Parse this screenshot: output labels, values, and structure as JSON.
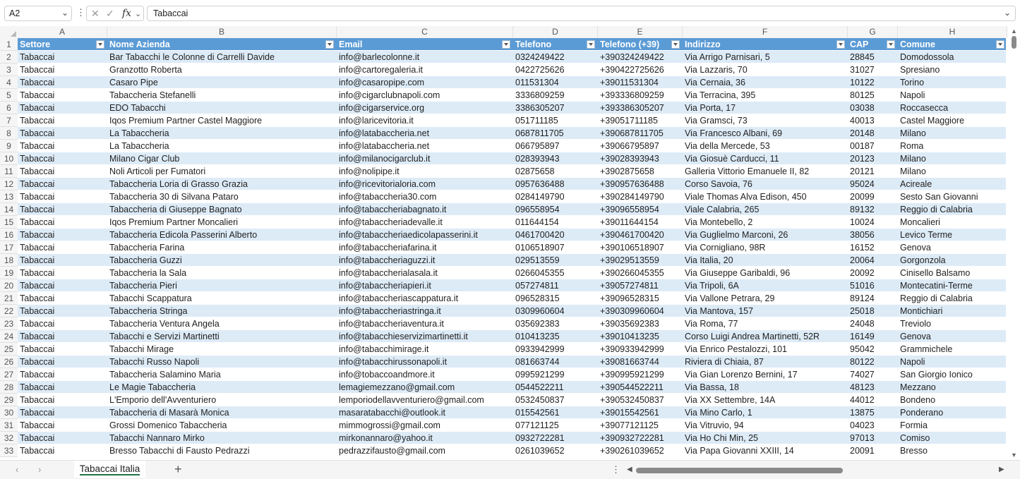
{
  "formula_bar": {
    "name_box": "A2",
    "formula": "Tabaccai"
  },
  "columns": [
    "A",
    "B",
    "C",
    "D",
    "E",
    "F",
    "G",
    "H"
  ],
  "header": [
    "Settore",
    "Nome Azienda",
    "Email",
    "Telefono",
    "Telefono (+39)",
    "Indirizzo",
    "CAP",
    "Comune"
  ],
  "rows": [
    [
      "Tabaccai",
      "Bar Tabacchi le Colonne di Carrelli Davide",
      "info@barlecolonne.it",
      "0324249422",
      "+390324249422",
      "Via Arrigo Parnisari, 5",
      "28845",
      "Domodossola"
    ],
    [
      "Tabaccai",
      "Granzotto Roberta",
      "info@cartoregaleria.it",
      "0422725626",
      "+390422725626",
      "Via Lazzaris, 70",
      "31027",
      "Spresiano"
    ],
    [
      "Tabaccai",
      "Casaro Pipe",
      "info@casaropipe.com",
      "011531304",
      "+39011531304",
      "Via Cernaia, 36",
      "10122",
      "Torino"
    ],
    [
      "Tabaccai",
      "Tabaccheria Stefanelli",
      "info@cigarclubnapoli.com",
      "3336809259",
      "+393336809259",
      "Via Terracina, 395",
      "80125",
      "Napoli"
    ],
    [
      "Tabaccai",
      "EDO Tabacchi",
      "info@cigarservice.org",
      "3386305207",
      "+393386305207",
      "Via Porta, 17",
      "03038",
      "Roccasecca"
    ],
    [
      "Tabaccai",
      "Iqos Premium Partner Castel Maggiore",
      "info@laricevitoria.it",
      "051711185",
      "+39051711185",
      "Via Gramsci, 73",
      "40013",
      "Castel Maggiore"
    ],
    [
      "Tabaccai",
      "La Tabaccheria",
      "info@latabaccheria.net",
      "0687811705",
      "+390687811705",
      "Via Francesco Albani, 69",
      "20148",
      "Milano"
    ],
    [
      "Tabaccai",
      "La Tabaccheria",
      "info@latabaccheria.net",
      "066795897",
      "+39066795897",
      "Via della Mercede, 53",
      "00187",
      "Roma"
    ],
    [
      "Tabaccai",
      "Milano Cigar Club",
      "info@milanocigarclub.it",
      "028393943",
      "+39028393943",
      "Via Giosuè Carducci, 11",
      "20123",
      "Milano"
    ],
    [
      "Tabaccai",
      "Noli Articoli per Fumatori",
      "info@nolipipe.it",
      "02875658",
      "+3902875658",
      "Galleria Vittorio Emanuele II, 82",
      "20121",
      "Milano"
    ],
    [
      "Tabaccai",
      "Tabaccheria Loria di Grasso Grazia",
      "info@ricevitorialoria.com",
      "0957636488",
      "+390957636488",
      "Corso Savoia, 76",
      "95024",
      "Acireale"
    ],
    [
      "Tabaccai",
      "Tabaccheria 30 di Silvana Pataro",
      "info@tabaccheria30.com",
      "0284149790",
      "+390284149790",
      "Viale Thomas Alva Edison, 450",
      "20099",
      "Sesto San Giovanni"
    ],
    [
      "Tabaccai",
      "Tabaccheria di Giuseppe Bagnato",
      "info@tabaccheriabagnato.it",
      "096558954",
      "+39096558954",
      "Viale Calabria, 265",
      "89132",
      "Reggio di Calabria"
    ],
    [
      "Tabaccai",
      "Iqos Premium Partner Moncalieri",
      "info@tabaccheriadevalle.it",
      "011644154",
      "+39011644154",
      "Via Montebello, 2",
      "10024",
      "Moncalieri"
    ],
    [
      "Tabaccai",
      "Tabaccheria Edicola Passerini Alberto",
      "info@tabaccheriaedicolapasserini.it",
      "0461700420",
      "+390461700420",
      "Via Guglielmo Marconi, 26",
      "38056",
      "Levico Terme"
    ],
    [
      "Tabaccai",
      "Tabaccheria Farina",
      "info@tabaccheriafarina.it",
      "0106518907",
      "+390106518907",
      "Via Cornigliano, 98R",
      "16152",
      "Genova"
    ],
    [
      "Tabaccai",
      "Tabaccheria Guzzi",
      "info@tabaccheriaguzzi.it",
      "029513559",
      "+39029513559",
      "Via Italia, 20",
      "20064",
      "Gorgonzola"
    ],
    [
      "Tabaccai",
      "Tabaccheria la Sala",
      "info@tabaccherialasala.it",
      "0266045355",
      "+390266045355",
      "Via Giuseppe Garibaldi, 96",
      "20092",
      "Cinisello Balsamo"
    ],
    [
      "Tabaccai",
      "Tabaccheria Pieri",
      "info@tabaccheriapieri.it",
      "057274811",
      "+39057274811",
      "Via Tripoli, 6A",
      "51016",
      "Montecatini-Terme"
    ],
    [
      "Tabaccai",
      "Tabacchi Scappatura",
      "info@tabaccheriascappatura.it",
      "096528315",
      "+39096528315",
      "Via Vallone Petrara, 29",
      "89124",
      "Reggio di Calabria"
    ],
    [
      "Tabaccai",
      "Tabaccheria Stringa",
      "info@tabaccheriastringa.it",
      "0309960604",
      "+390309960604",
      "Via Mantova, 157",
      "25018",
      "Montichiari"
    ],
    [
      "Tabaccai",
      "Tabaccheria Ventura Angela",
      "info@tabaccheriaventura.it",
      "035692383",
      "+39035692383",
      "Via Roma, 77",
      "24048",
      "Treviolo"
    ],
    [
      "Tabaccai",
      "Tabacchi e Servizi Martinetti",
      "info@tabacchieservizimartinetti.it",
      "010413235",
      "+39010413235",
      "Corso Luigi Andrea Martinetti, 52R",
      "16149",
      "Genova"
    ],
    [
      "Tabaccai",
      "Tabacchi Mirage",
      "info@tabacchimirage.it",
      "0933942999",
      "+390933942999",
      "Via Enrico Pestalozzi, 101",
      "95042",
      "Grammichele"
    ],
    [
      "Tabaccai",
      "Tabacchi Russo Napoli",
      "info@tabacchirussonapoli.it",
      "081663744",
      "+39081663744",
      "Riviera di Chiaia, 87",
      "80122",
      "Napoli"
    ],
    [
      "Tabaccai",
      "Tabaccheria Salamino Maria",
      "info@tobaccoandmore.it",
      "0995921299",
      "+390995921299",
      "Via Gian Lorenzo Bernini, 17",
      "74027",
      "San Giorgio Ionico"
    ],
    [
      "Tabaccai",
      "Le Magie Tabaccheria",
      "lemagiemezzano@gmail.com",
      "0544522211",
      "+390544522211",
      "Via Bassa, 18",
      "48123",
      "Mezzano"
    ],
    [
      "Tabaccai",
      "L'Emporio dell'Avventuriero",
      "lemporiodellavventuriero@gmail.com",
      "0532450837",
      "+390532450837",
      "Via XX Settembre, 14A",
      "44012",
      "Bondeno"
    ],
    [
      "Tabaccai",
      "Tabaccheria di Masarà Monica",
      "masaratabacchi@outlook.it",
      "015542561",
      "+39015542561",
      "Via Mino Carlo, 1",
      "13875",
      "Ponderano"
    ],
    [
      "Tabaccai",
      "Grossi Domenico Tabaccheria",
      "mimmogrossi@gmail.com",
      "077121125",
      "+39077121125",
      "Via Vitruvio, 94",
      "04023",
      "Formia"
    ],
    [
      "Tabaccai",
      "Tabacchi Nannaro Mirko",
      "mirkonannaro@yahoo.it",
      "0932722281",
      "+390932722281",
      "Via Ho Chi Min, 25",
      "97013",
      "Comiso"
    ],
    [
      "Tabaccai",
      "Bresso Tabacchi di Fausto Pedrazzi",
      "pedrazzifausto@gmail.com",
      "0261039652",
      "+390261039652",
      "Via Papa Giovanni XXIII, 14",
      "20091",
      "Bresso"
    ]
  ],
  "sheet_tab": "Tabaccai Italia",
  "colors": {
    "header_fill": "#5b9bd5",
    "band_fill": "#ddebf7",
    "tab_underline": "#217346"
  }
}
